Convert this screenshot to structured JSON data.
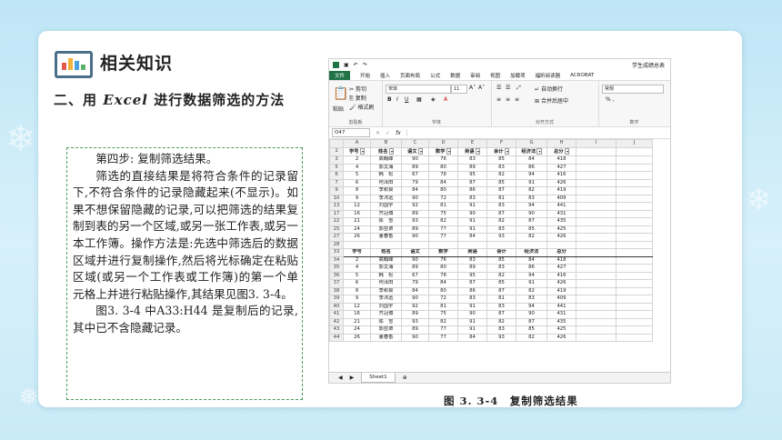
{
  "header": {
    "title": "相关知识"
  },
  "subtitle": {
    "prefix": "二、用 ",
    "emph": "Excel",
    "suffix": " 进行数据筛选的方法"
  },
  "text_box": {
    "p1": "第四步: 复制筛选结果。",
    "p2": "筛选的直接结果是将符合条件的记录留下,不符合条件的记录隐藏起来(不显示)。如果不想保留隐藏的记录,可以把筛选的结果复制到表的另一个区域,或另一张工作表,或另一本工作簿。操作方法是:先选中筛选后的数据区域并进行复制操作,然后将光标确定在粘贴区域(或另一个工作表或工作簿)的第一个单元格上并进行粘贴操作,其结果见图3. 3-4。",
    "p3": "图3. 3-4 中A33:H44 是复制后的记录,其中已不含隐藏记录。"
  },
  "excel": {
    "filename": "学生成绩总表",
    "tabs": [
      "文件",
      "开始",
      "插入",
      "页面布局",
      "公式",
      "数据",
      "审阅",
      "视图",
      "加载项",
      "福昕阅读器",
      "ACROBAT"
    ],
    "ribbon": {
      "cut": "剪切",
      "copy": "复制",
      "format_painter": "格式刷",
      "paste": "粘贴",
      "font_name": "宋体",
      "font_size": "11",
      "wrap": "自动换行",
      "merge": "合并后居中",
      "number_format": "常规",
      "groups": [
        "剪贴板",
        "字体",
        "对齐方式",
        "数字"
      ]
    },
    "name_box": "O47",
    "fx": "fx",
    "col_letters": [
      "A",
      "B",
      "C",
      "D",
      "E",
      "F",
      "G",
      "H",
      "I",
      "J"
    ],
    "header_row": [
      "学号",
      "姓名",
      "语文",
      "数学",
      "英语",
      "会计",
      "经济法",
      "总分"
    ],
    "top_rows": [
      {
        "r": "1",
        "cells": [
          "学号",
          "姓名",
          "语文",
          "数学",
          "英语",
          "会计",
          "经济法",
          "总分"
        ]
      },
      {
        "r": "3",
        "cells": [
          "2",
          "高翰峰",
          "90",
          "76",
          "83",
          "85",
          "84",
          "418"
        ]
      },
      {
        "r": "5",
        "cells": [
          "4",
          "郭文海",
          "89",
          "80",
          "89",
          "83",
          "86",
          "427"
        ]
      },
      {
        "r": "6",
        "cells": [
          "5",
          "韩　松",
          "67",
          "78",
          "95",
          "82",
          "94",
          "416"
        ]
      },
      {
        "r": "7",
        "cells": [
          "6",
          "何泽田",
          "79",
          "84",
          "87",
          "85",
          "91",
          "426"
        ]
      },
      {
        "r": "9",
        "cells": [
          "8",
          "李和良",
          "84",
          "80",
          "86",
          "87",
          "82",
          "419"
        ]
      },
      {
        "r": "10",
        "cells": [
          "9",
          "李沐远",
          "90",
          "72",
          "83",
          "81",
          "83",
          "409"
        ]
      },
      {
        "r": "13",
        "cells": [
          "12",
          "刘国宇",
          "92",
          "81",
          "91",
          "83",
          "94",
          "441"
        ]
      },
      {
        "r": "17",
        "cells": [
          "16",
          "齐冠博",
          "89",
          "75",
          "90",
          "87",
          "90",
          "431"
        ]
      },
      {
        "r": "22",
        "cells": [
          "21",
          "陈　雪",
          "93",
          "82",
          "91",
          "82",
          "87",
          "435"
        ]
      },
      {
        "r": "25",
        "cells": [
          "24",
          "郭亚卓",
          "89",
          "77",
          "91",
          "83",
          "85",
          "425"
        ]
      },
      {
        "r": "27",
        "cells": [
          "26",
          "董春香",
          "90",
          "77",
          "84",
          "93",
          "82",
          "426"
        ]
      },
      {
        "r": "28",
        "cells": [
          "",
          "",
          "",
          "",
          "",
          "",
          "",
          ""
        ]
      }
    ],
    "bottom_rows": [
      {
        "r": "33",
        "cells": [
          "学号",
          "姓名",
          "语文",
          "数学",
          "英语",
          "会计",
          "经济法",
          "总分"
        ]
      },
      {
        "r": "34",
        "cells": [
          "2",
          "高翰峰",
          "90",
          "76",
          "83",
          "85",
          "84",
          "418"
        ]
      },
      {
        "r": "35",
        "cells": [
          "4",
          "郭文海",
          "89",
          "80",
          "89",
          "83",
          "86",
          "427"
        ]
      },
      {
        "r": "36",
        "cells": [
          "5",
          "韩　松",
          "67",
          "78",
          "95",
          "82",
          "94",
          "416"
        ]
      },
      {
        "r": "37",
        "cells": [
          "6",
          "何泽田",
          "79",
          "84",
          "87",
          "85",
          "91",
          "426"
        ]
      },
      {
        "r": "38",
        "cells": [
          "8",
          "李和良",
          "84",
          "80",
          "86",
          "87",
          "82",
          "419"
        ]
      },
      {
        "r": "39",
        "cells": [
          "9",
          "李沐远",
          "90",
          "72",
          "83",
          "81",
          "83",
          "409"
        ]
      },
      {
        "r": "40",
        "cells": [
          "12",
          "刘国宇",
          "92",
          "81",
          "91",
          "83",
          "94",
          "441"
        ]
      },
      {
        "r": "41",
        "cells": [
          "16",
          "齐冠博",
          "89",
          "75",
          "90",
          "87",
          "90",
          "431"
        ]
      },
      {
        "r": "42",
        "cells": [
          "21",
          "陈　雪",
          "93",
          "82",
          "91",
          "82",
          "87",
          "435"
        ]
      },
      {
        "r": "43",
        "cells": [
          "24",
          "郭亚卓",
          "89",
          "77",
          "91",
          "83",
          "85",
          "425"
        ]
      },
      {
        "r": "44",
        "cells": [
          "26",
          "董春香",
          "90",
          "77",
          "84",
          "93",
          "82",
          "426"
        ]
      }
    ],
    "sheet_tab": "Sheet1",
    "add_sheet": "⊕"
  },
  "caption": "图 3. 3-4　复制筛选结果",
  "colors": {
    "accent": "#217346",
    "box_border": "#4d9a62"
  }
}
